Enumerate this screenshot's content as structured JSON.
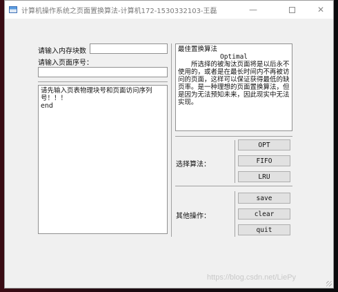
{
  "window": {
    "title": "计算机操作系统之页面置换算法-计算机172-1530332103-王磊",
    "controls": {
      "minimize": "—",
      "maximize_icon": "maximize-icon",
      "close": "✕"
    }
  },
  "form": {
    "memory_blocks_label": "请输入内存块数",
    "memory_blocks_value": "",
    "page_sequence_label": "请输入页面序号：",
    "page_sequence_value": ""
  },
  "output": {
    "lines": [
      "请先输入页表物理块号和页面访问序列号！！！",
      "end"
    ]
  },
  "description": {
    "title": "最佳置换算法",
    "subtitle": "Optimal",
    "body": "所选择的被淘汰页面将是以后永不使用的，或者是在最长时间内不再被访问的页面，这样可以保证获得最低的缺页率。是一种理想的页面置换算法，但是因为无法预知未来，因此现实中无法实现。"
  },
  "algorithm": {
    "label": "选择算法：",
    "buttons": [
      "OPT",
      "FIFO",
      "LRU"
    ]
  },
  "other": {
    "label": "其他操作：",
    "buttons": [
      "save",
      "clear",
      "quit"
    ]
  },
  "watermark": "https://blog.csdn.net/LiePy"
}
